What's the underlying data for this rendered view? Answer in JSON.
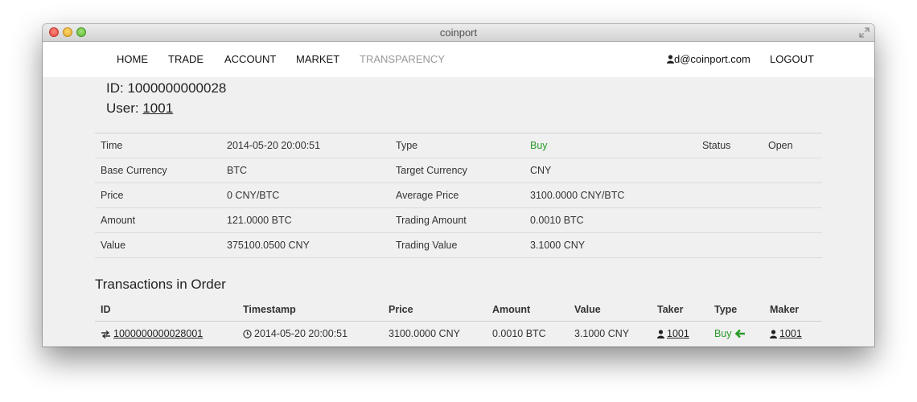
{
  "window": {
    "title": "coinport"
  },
  "nav": {
    "items": [
      {
        "label": "HOME",
        "name": "nav-home"
      },
      {
        "label": "TRADE",
        "name": "nav-trade"
      },
      {
        "label": "ACCOUNT",
        "name": "nav-account"
      },
      {
        "label": "MARKET",
        "name": "nav-market"
      },
      {
        "label": "TRANSPARENCY",
        "name": "nav-transparency"
      }
    ],
    "user_email": "d@coinport.com",
    "logout_label": "LOGOUT"
  },
  "order": {
    "id_label": "ID: ",
    "id_value": "1000000000028",
    "user_label": "User: ",
    "user_value": "1001"
  },
  "details": {
    "time_label": "Time",
    "time_value": "2014-05-20 20:00:51",
    "type_label": "Type",
    "type_value": "Buy",
    "status_label": "Status",
    "status_value": "Open",
    "base_label": "Base Currency",
    "base_value": "BTC",
    "target_label": "Target Currency",
    "target_value": "CNY",
    "price_label": "Price",
    "price_value": "0 CNY/BTC",
    "avgprice_label": "Average Price",
    "avgprice_value": "3100.0000 CNY/BTC",
    "amount_label": "Amount",
    "amount_value": "121.0000 BTC",
    "tradeamount_label": "Trading Amount",
    "tradeamount_value": "0.0010 BTC",
    "value_label": "Value",
    "value_value": "375100.0500 CNY",
    "tradevalue_label": "Trading Value",
    "tradevalue_value": "3.1000 CNY"
  },
  "transactions": {
    "title": "Transactions in Order",
    "headers": [
      "ID",
      "Timestamp",
      "Price",
      "Amount",
      "Value",
      "Taker",
      "Type",
      "Maker"
    ],
    "rows": [
      {
        "id": "1000000000028001",
        "timestamp": "2014-05-20 20:00:51",
        "price": "3100.0000 CNY",
        "amount": "0.0010 BTC",
        "value": "3.1000 CNY",
        "taker": "1001",
        "type": "Buy",
        "maker": "1001"
      }
    ]
  },
  "colors": {
    "buy_green": "#2a9a2a",
    "nav_muted": "#999999"
  },
  "icons": {
    "user": "user-icon",
    "transaction": "exchange-icon",
    "clock": "clock-icon",
    "buy_arrow": "arrow-left-icon"
  }
}
